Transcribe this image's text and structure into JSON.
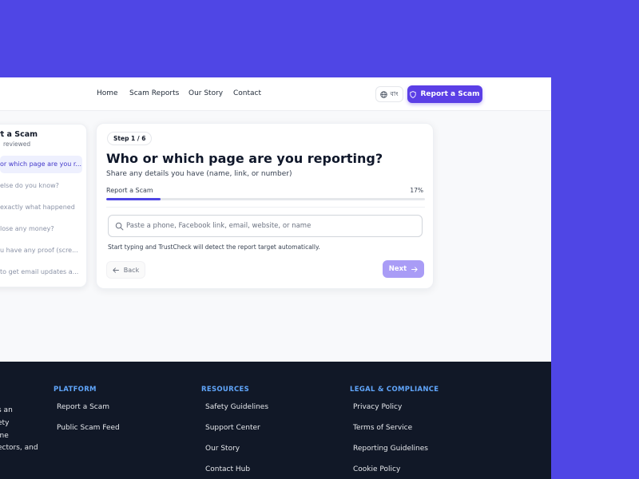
{
  "header": {
    "nav": [
      "Home",
      "Scam Reports",
      "Our Story",
      "Contact"
    ],
    "lang_label": "বাং",
    "report_button": "Report a Scam"
  },
  "steps": {
    "title": "rt a Scam",
    "subtitle": "reviewed",
    "items": [
      "or which page are you r...",
      "else do you know?",
      "exactly what happened",
      "lose any money?",
      "u have any proof (scre...",
      "to get email updates a..."
    ],
    "active_index": 0
  },
  "form": {
    "step_badge": "Step 1 / 6",
    "title": "Who or which page are you reporting?",
    "description": "Share any details you have (name, link, or number)",
    "progress_label": "Report a Scam",
    "progress_text": "17%",
    "progress_value": 0.17,
    "input_placeholder": "Paste a phone, Facebook link, email, website, or name",
    "input_value": "",
    "helper": "Start typing and TrustCheck will detect the report target automatically.",
    "back_label": "Back",
    "next_label": "Next"
  },
  "footer": {
    "brand_lines": [
      "s an",
      "ety",
      "ine",
      "ectors, and"
    ],
    "columns": [
      {
        "heading": "PLATFORM",
        "links": [
          "Report a Scam",
          "Public Scam Feed"
        ]
      },
      {
        "heading": "RESOURCES",
        "links": [
          "Safety Guidelines",
          "Support Center",
          "Our Story",
          "Contact Hub"
        ]
      },
      {
        "heading": "LEGAL & COMPLIANCE",
        "links": [
          "Privacy Policy",
          "Terms of Service",
          "Reporting Guidelines",
          "Cookie Policy"
        ]
      }
    ]
  },
  "colors": {
    "background": "#4f46e5",
    "accent": "#5b3fe6",
    "next_disabled": "#a99cf6",
    "footer_bg": "#111827",
    "footer_heading": "#60a5fa"
  },
  "icons": [
    "globe-icon",
    "shield-icon",
    "search-icon",
    "arrow-left-icon",
    "arrow-right-icon"
  ]
}
